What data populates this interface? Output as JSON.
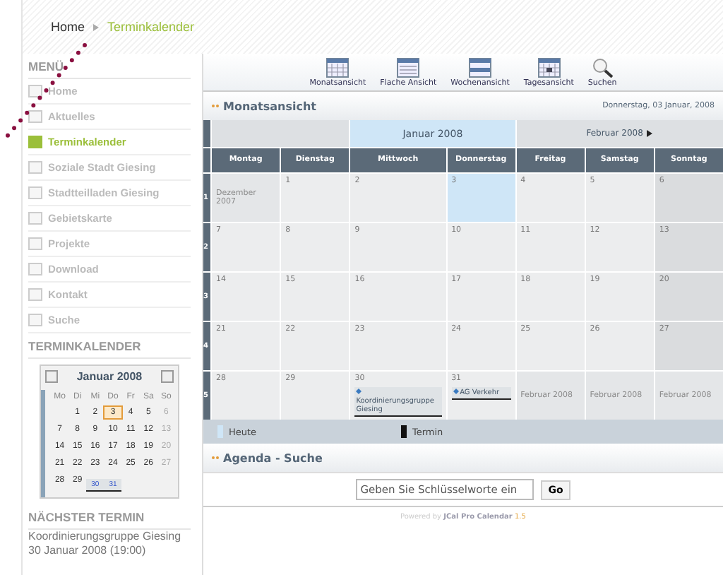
{
  "breadcrumb": [
    {
      "label": "Home",
      "selected": false
    },
    {
      "label": "Terminkalender",
      "selected": true
    }
  ],
  "menu": {
    "title": "MENÜ",
    "items": [
      {
        "label": "Home",
        "selected": false
      },
      {
        "label": "Aktuelles",
        "selected": false
      },
      {
        "label": "Terminkalender",
        "selected": true
      },
      {
        "label": "Soziale Stadt Giesing",
        "selected": false
      },
      {
        "label": "Stadtteilladen Giesing",
        "selected": false
      },
      {
        "label": "Gebietskarte",
        "selected": false
      },
      {
        "label": "Projekte",
        "selected": false
      },
      {
        "label": "Download",
        "selected": false
      },
      {
        "label": "Kontakt",
        "selected": false
      },
      {
        "label": "Suche",
        "selected": false
      }
    ]
  },
  "mini_calendar": {
    "title": "TERMINKALENDER",
    "month": "Januar 2008",
    "weekdays": [
      "Mo",
      "Di",
      "Mi",
      "Do",
      "Fr",
      "Sa",
      "So"
    ],
    "weeks": [
      [
        {
          "day": "1",
          "today": false,
          "event": false
        },
        {
          "day": "2",
          "today": false,
          "event": false
        },
        {
          "day": "3",
          "today": true,
          "event": false
        },
        {
          "day": "4",
          "today": false,
          "event": false
        },
        {
          "day": "5",
          "today": false,
          "event": false
        },
        {
          "day": "6",
          "today": false,
          "event": false
        }
      ],
      [
        {
          "day": "7",
          "today": false,
          "event": false
        },
        {
          "day": "8",
          "today": false,
          "event": false
        },
        {
          "day": "9",
          "today": false,
          "event": false
        },
        {
          "day": "10",
          "today": false,
          "event": false
        },
        {
          "day": "11",
          "today": false,
          "event": false
        },
        {
          "day": "12",
          "today": false,
          "event": false
        },
        {
          "day": "13",
          "today": false,
          "event": false
        }
      ],
      [
        {
          "day": "14",
          "today": false,
          "event": false
        },
        {
          "day": "15",
          "today": false,
          "event": false
        },
        {
          "day": "16",
          "today": false,
          "event": false
        },
        {
          "day": "17",
          "today": false,
          "event": false
        },
        {
          "day": "18",
          "today": false,
          "event": false
        },
        {
          "day": "19",
          "today": false,
          "event": false
        },
        {
          "day": "20",
          "today": false,
          "event": false
        }
      ],
      [
        {
          "day": "21",
          "today": false,
          "event": false
        },
        {
          "day": "22",
          "today": false,
          "event": false
        },
        {
          "day": "23",
          "today": false,
          "event": false
        },
        {
          "day": "24",
          "today": false,
          "event": false
        },
        {
          "day": "25",
          "today": false,
          "event": false
        },
        {
          "day": "26",
          "today": false,
          "event": false
        },
        {
          "day": "27",
          "today": false,
          "event": false
        }
      ],
      [
        {
          "day": "28",
          "today": false,
          "event": false
        },
        {
          "day": "29",
          "today": false,
          "event": false
        },
        {
          "day": "30",
          "today": false,
          "event": true
        },
        {
          "day": "31",
          "today": false,
          "event": true
        }
      ]
    ]
  },
  "next_event": {
    "title": "NÄCHSTER TERMIN",
    "name": "Koordinierungsgruppe Giesing",
    "date": "30 Januar 2008 (19:00)"
  },
  "toolbar": [
    {
      "kind": "month",
      "label": "Monatsansicht"
    },
    {
      "kind": "flat",
      "label": "Flache Ansicht"
    },
    {
      "kind": "week",
      "label": "Wochenansicht"
    },
    {
      "kind": "day",
      "label": "Tagesansicht"
    },
    {
      "kind": "search",
      "label": "Suchen"
    }
  ],
  "month_view": {
    "title": "Monatsansicht",
    "date": "Donnerstag, 03 Januar, 2008",
    "current_month": "Januar 2008",
    "next_month": "Februar 2008",
    "weekdays": [
      "Montag",
      "Dienstag",
      "Mittwoch",
      "Donnerstag",
      "Freitag",
      "Samstag",
      "Sonntag"
    ],
    "weeks": [
      {
        "number": "1",
        "days": [
          {
            "kind": "other",
            "label": "Dezember 2007"
          },
          {
            "kind": "day",
            "label": "1"
          },
          {
            "kind": "day",
            "label": "2"
          },
          {
            "kind": "today",
            "label": "3"
          },
          {
            "kind": "day",
            "label": "4"
          },
          {
            "kind": "day",
            "label": "5"
          },
          {
            "kind": "day",
            "label": "6"
          }
        ]
      },
      {
        "number": "2",
        "days": [
          {
            "kind": "day",
            "label": "7"
          },
          {
            "kind": "day",
            "label": "8"
          },
          {
            "kind": "day",
            "label": "9"
          },
          {
            "kind": "day",
            "label": "10"
          },
          {
            "kind": "day",
            "label": "11"
          },
          {
            "kind": "day",
            "label": "12"
          },
          {
            "kind": "day",
            "label": "13"
          }
        ]
      },
      {
        "number": "3",
        "days": [
          {
            "kind": "day",
            "label": "14"
          },
          {
            "kind": "day",
            "label": "15"
          },
          {
            "kind": "day",
            "label": "16"
          },
          {
            "kind": "day",
            "label": "17"
          },
          {
            "kind": "day",
            "label": "18"
          },
          {
            "kind": "day",
            "label": "19"
          },
          {
            "kind": "day",
            "label": "20"
          }
        ]
      },
      {
        "number": "4",
        "days": [
          {
            "kind": "day",
            "label": "21"
          },
          {
            "kind": "day",
            "label": "22"
          },
          {
            "kind": "day",
            "label": "23"
          },
          {
            "kind": "day",
            "label": "24"
          },
          {
            "kind": "day",
            "label": "25"
          },
          {
            "kind": "day",
            "label": "26"
          },
          {
            "kind": "day",
            "label": "27"
          }
        ]
      },
      {
        "number": "5",
        "days": [
          {
            "kind": "day",
            "label": "28"
          },
          {
            "kind": "day",
            "label": "29"
          },
          {
            "kind": "day",
            "label": "30",
            "event": "Koordinierungsgruppe Giesing"
          },
          {
            "kind": "day",
            "label": "31",
            "event": "AG Verkehr"
          },
          {
            "kind": "other",
            "label": "Februar 2008"
          },
          {
            "kind": "other",
            "label": "Februar 2008"
          },
          {
            "kind": "other",
            "label": "Februar 2008"
          }
        ]
      }
    ],
    "legend": [
      "Heute",
      "Termin"
    ]
  },
  "agenda": {
    "title": "Agenda - Suche",
    "placeholder": "Geben Sie Schlüsselworte ein",
    "button": "Go"
  },
  "footer": {
    "prefix": "Powered by",
    "product": "JCal Pro Calendar",
    "version": "1.5"
  }
}
